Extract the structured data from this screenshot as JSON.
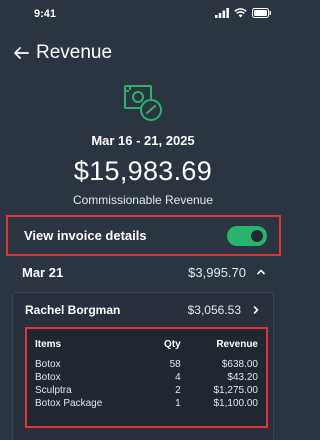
{
  "status_bar": {
    "time": "9:41"
  },
  "header": {
    "title": "Revenue"
  },
  "summary": {
    "date_range": "Mar 16 - 21, 2025",
    "amount": "$15,983.69",
    "caption": "Commissionable Revenue"
  },
  "toggle": {
    "label": "View invoice details",
    "on": true
  },
  "day": {
    "label": "Mar 21",
    "amount": "$3,995.70"
  },
  "patient": {
    "name": "Rachel Borgman",
    "amount": "$3,056.53"
  },
  "items": {
    "headers": {
      "item": "Items",
      "qty": "Qty",
      "revenue": "Revenue"
    },
    "rows": [
      {
        "item": "Botox",
        "qty": "58",
        "revenue": "$638.00"
      },
      {
        "item": "Botox",
        "qty": "4",
        "revenue": "$43.20"
      },
      {
        "item": "Sculptra",
        "qty": "2",
        "revenue": "$1,275.00"
      },
      {
        "item": "Botox Package",
        "qty": "1",
        "revenue": "$1,100.00"
      }
    ]
  },
  "colors": {
    "background": "#2b3542",
    "accent_green": "#28b36f",
    "highlight_red": "#e0323a"
  },
  "icons": {
    "back": "arrow-left-icon",
    "hero": "commission-money-icon",
    "expand": "chevron-up-icon",
    "drill": "chevron-right-icon"
  }
}
